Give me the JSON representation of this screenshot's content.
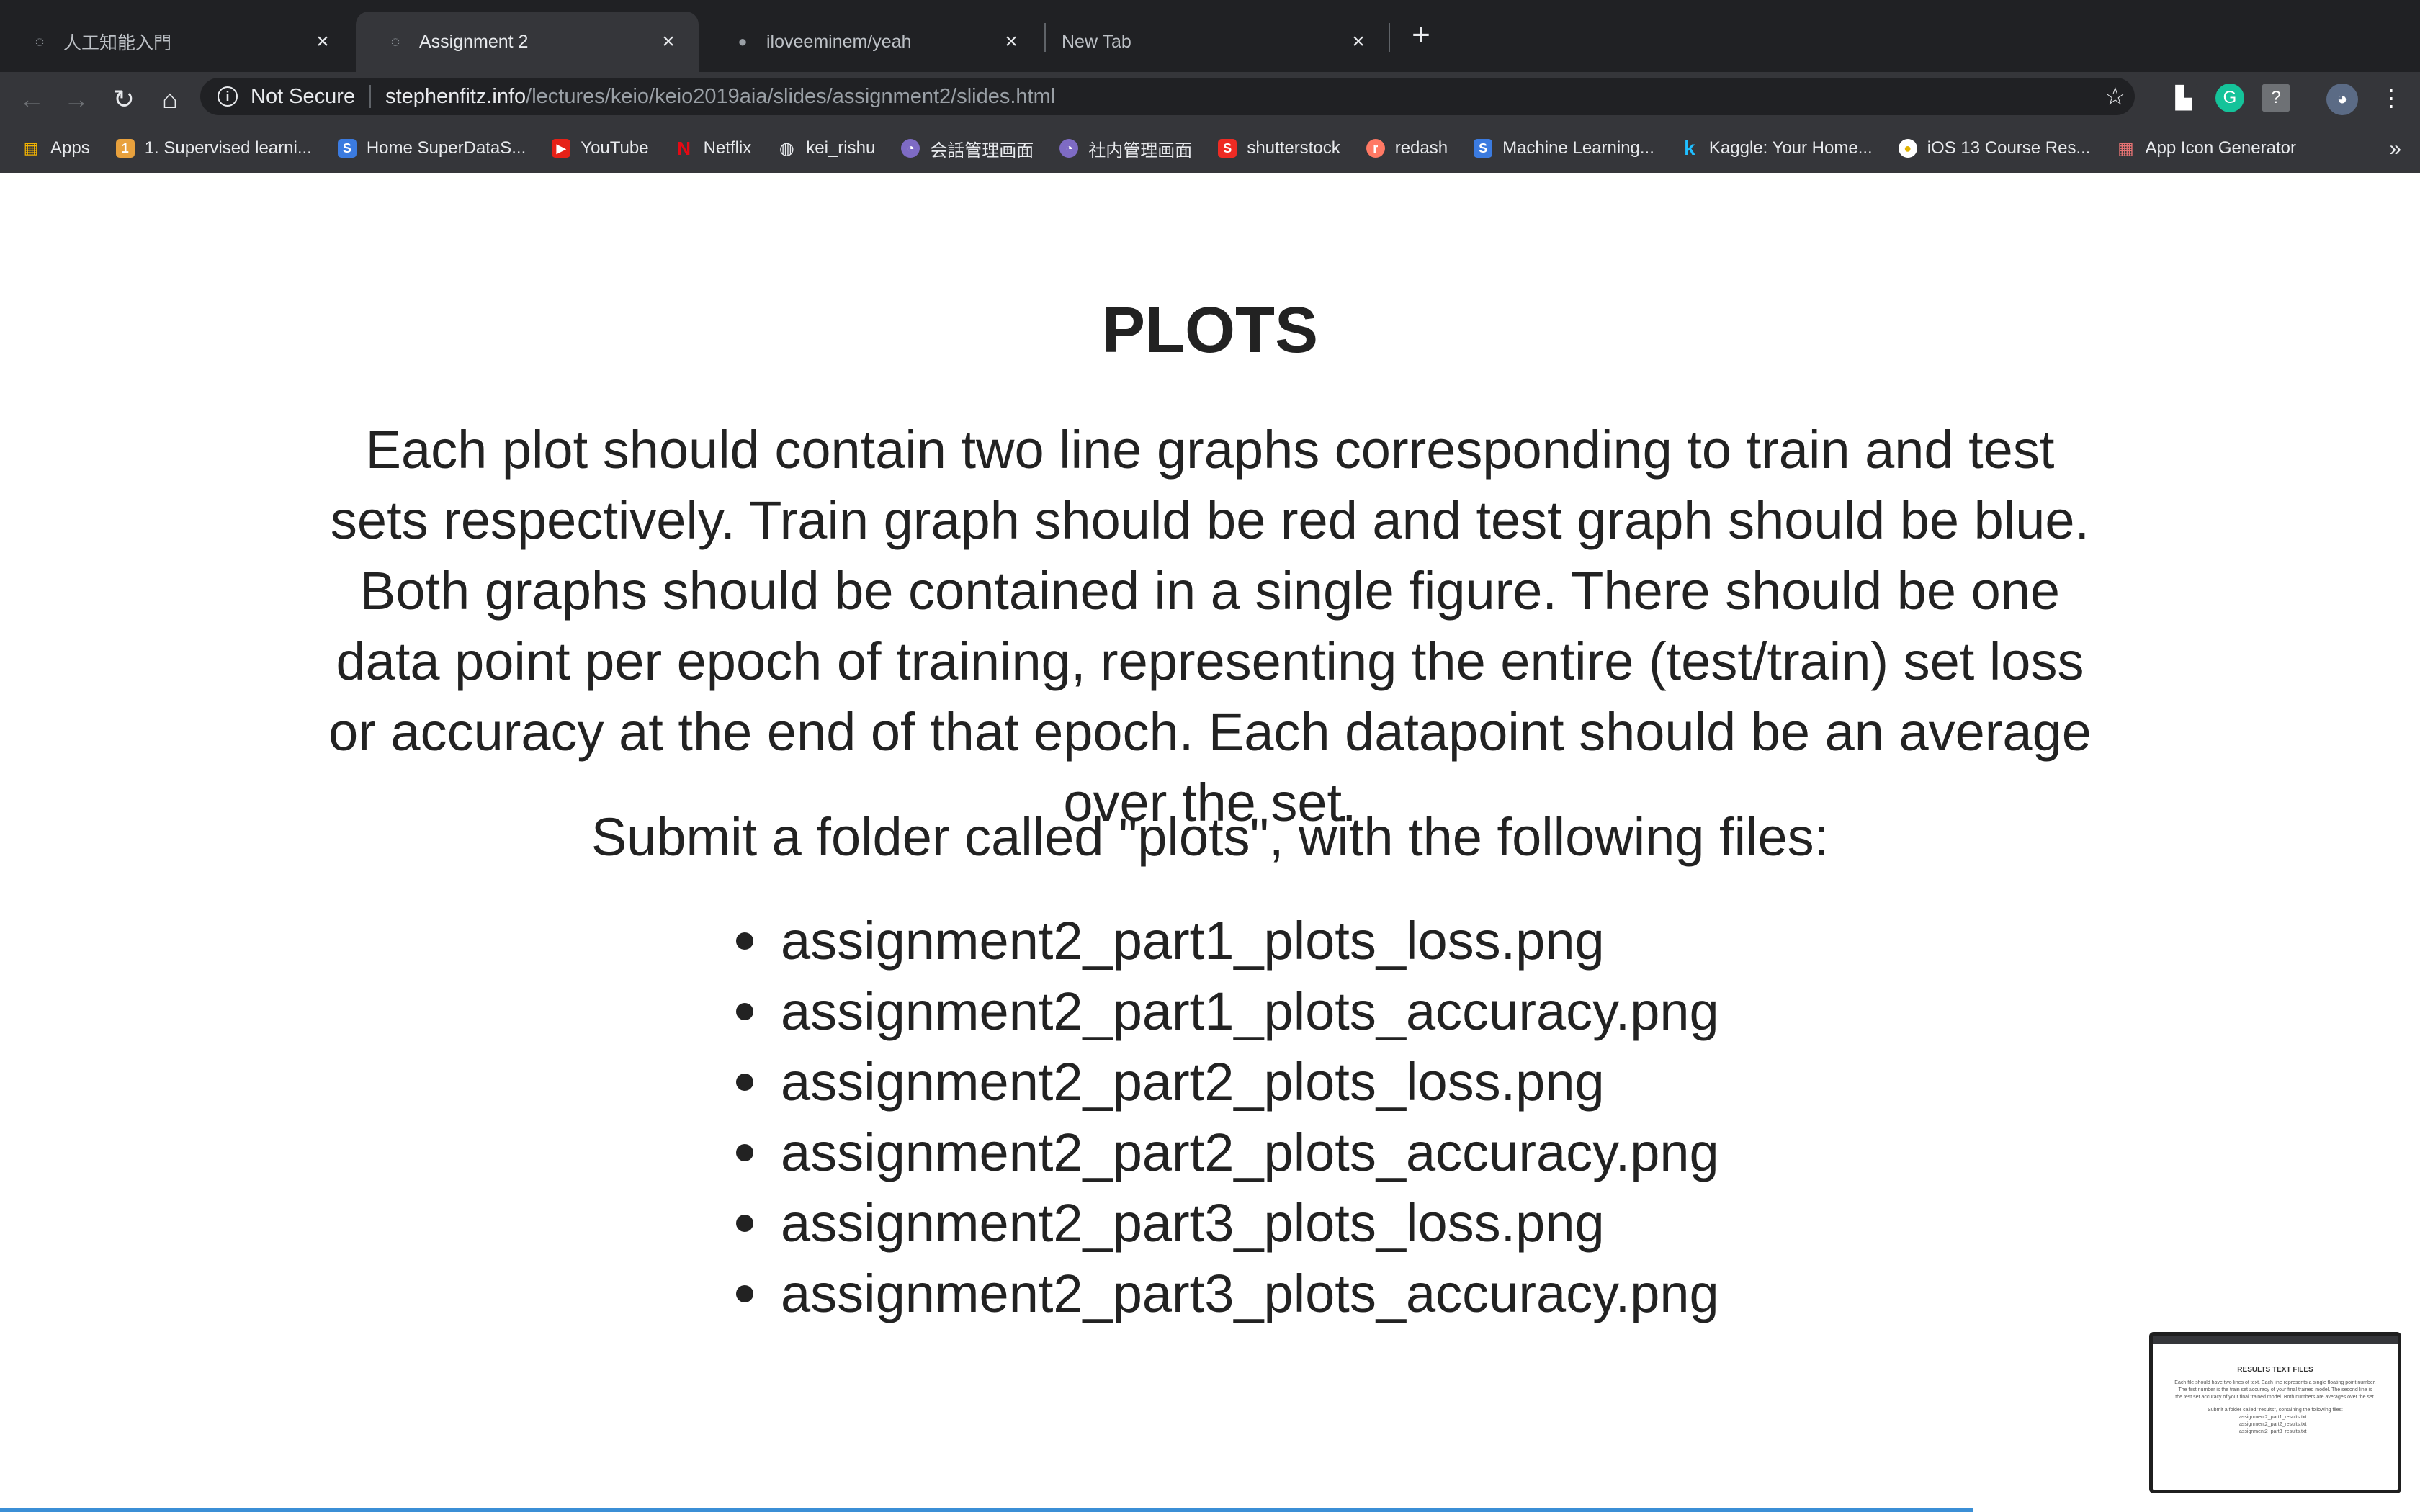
{
  "browser": {
    "tabs": [
      {
        "title": "人工知能入門",
        "active": false
      },
      {
        "title": "Assignment 2",
        "active": true
      },
      {
        "title": "iloveeminem/yeah",
        "active": false
      },
      {
        "title": "New Tab",
        "active": false
      }
    ],
    "address": {
      "security_label": "Not Secure",
      "host": "stephenfitz.info",
      "path": "/lectures/keio/keio2019aia/slides/assignment2/slides.html"
    },
    "bookmarks": [
      {
        "label": "Apps",
        "icon": "apps-grid-icon"
      },
      {
        "label": "1. Supervised learni...",
        "icon": "bookmark-favicon"
      },
      {
        "label": "Home SuperDataS...",
        "icon": "superdatascience-icon"
      },
      {
        "label": "YouTube",
        "icon": "youtube-icon"
      },
      {
        "label": "Netflix",
        "icon": "netflix-icon"
      },
      {
        "label": "kei_rishu",
        "icon": "globe-icon"
      },
      {
        "label": "会話管理画面",
        "icon": "bookmark-favicon"
      },
      {
        "label": "社内管理画面",
        "icon": "bookmark-favicon"
      },
      {
        "label": "shutterstock",
        "icon": "shutterstock-icon"
      },
      {
        "label": "redash",
        "icon": "redash-icon"
      },
      {
        "label": "Machine Learning...",
        "icon": "bookmark-favicon"
      },
      {
        "label": "Kaggle: Your Home...",
        "icon": "kaggle-icon"
      },
      {
        "label": "iOS 13 Course Res...",
        "icon": "bookmark-favicon"
      },
      {
        "label": "App Icon Generator",
        "icon": "bookmark-favicon"
      }
    ],
    "bookmarks_overflow": "»"
  },
  "slide": {
    "title": "PLOTS",
    "body": "Each plot should contain two line graphs corresponding to train and test sets respectively. Train graph should be red and test graph should be blue. Both graphs should be contained in a single figure. There should be one data point per epoch of training, representing the entire (test/train) set loss or accuracy at the end of that epoch. Each datapoint should be an average over the set.",
    "submit_text": "Submit a folder called \"plots\", with the following files:",
    "files": [
      "assignment2_part1_plots_loss.png",
      "assignment2_part1_plots_accuracy.png",
      "assignment2_part2_plots_loss.png",
      "assignment2_part2_plots_accuracy.png",
      "assignment2_part3_plots_loss.png",
      "assignment2_part3_plots_accuracy.png"
    ]
  },
  "thumbnail": {
    "title": "RESULTS TEXT FILES",
    "body": "Each file should have two lines of text. Each line represents a single floating point number. The first number is the train set accuracy of your final trained model. The second line is the test set accuracy of your final trained model. Both numbers are averages over the set.",
    "submit_text": "Submit a folder called \"results\", containing the following files:",
    "files": [
      "assignment2_part1_results.txt",
      "assignment2_part2_results.txt",
      "assignment2_part3_results.txt"
    ]
  },
  "colors": {
    "accent": "#3b8fd6",
    "toolbar": "#35363a",
    "tabstrip": "#202124",
    "text": "#222222"
  }
}
